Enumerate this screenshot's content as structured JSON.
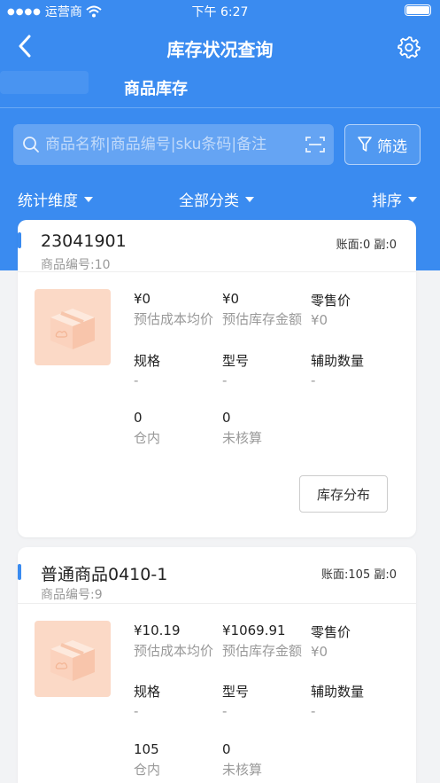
{
  "status_bar": {
    "carrier": "运营商",
    "time": "下午 6:27"
  },
  "nav": {
    "title": "库存状况查询"
  },
  "tabs": [
    {
      "label": "商品库存",
      "active": true
    }
  ],
  "search": {
    "placeholder": "商品名称|商品编号|sku条码|备注",
    "filter_label": "筛选"
  },
  "filters": {
    "dimension": "统计维度",
    "category": "全部分类",
    "sort": "排序"
  },
  "colors": {
    "primary": "#3a8bf0",
    "card_bg": "#ffffff",
    "page_bg": "#f2f3f5"
  },
  "products": [
    {
      "name": "23041901",
      "code_label": "商品编号:",
      "code": "10",
      "account": "账面:0 副:0",
      "avg_cost": "¥0",
      "avg_cost_label": "预估成本均价",
      "stock_amount": "¥0",
      "stock_amount_label": "预估库存金额",
      "retail_label": "零售价",
      "retail": "¥0",
      "spec_label": "规格",
      "spec": "-",
      "model_label": "型号",
      "model": "-",
      "aux_label": "辅助数量",
      "aux": "-",
      "in_stock": "0",
      "in_stock_label": "仓内",
      "unsettled": "0",
      "unsettled_label": "未核算",
      "dist_button": "库存分布"
    },
    {
      "name": "普通商品0410-1",
      "code_label": "商品编号:",
      "code": "9",
      "account": "账面:105 副:0",
      "avg_cost": "¥10.19",
      "avg_cost_label": "预估成本均价",
      "stock_amount": "¥1069.91",
      "stock_amount_label": "预估库存金额",
      "retail_label": "零售价",
      "retail": "¥0",
      "spec_label": "规格",
      "spec": "-",
      "model_label": "型号",
      "model": "-",
      "aux_label": "辅助数量",
      "aux": "-",
      "in_stock": "105",
      "in_stock_label": "仓内",
      "unsettled": "0",
      "unsettled_label": "未核算"
    }
  ]
}
